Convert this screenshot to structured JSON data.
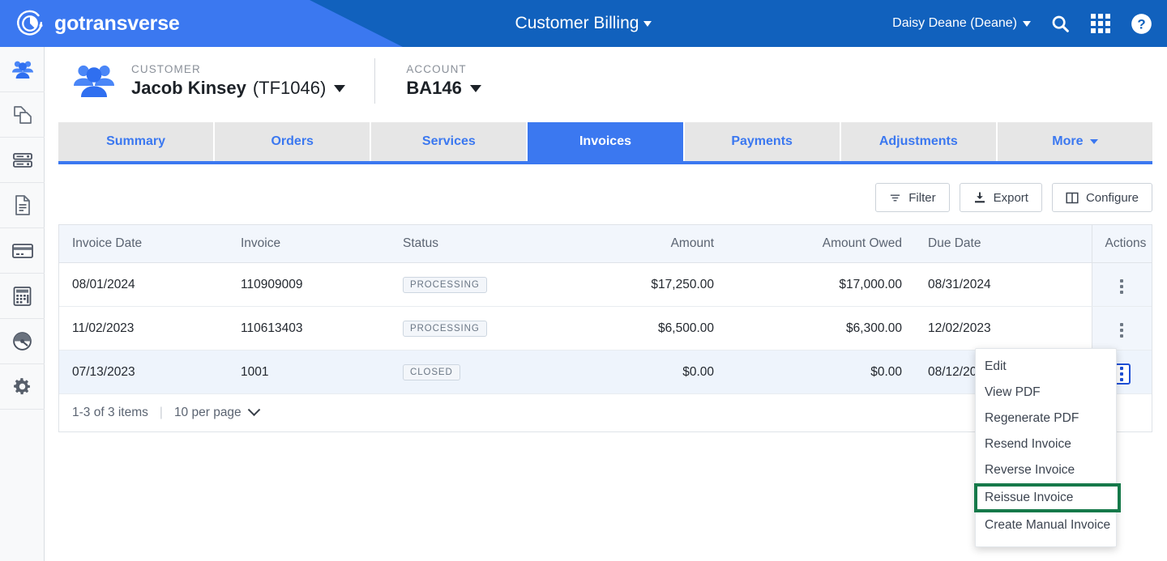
{
  "topbar": {
    "brand": "gotransverse",
    "title": "Customer Billing",
    "user": "Daisy Deane (Deane)",
    "icons": {
      "search": "search-icon",
      "apps": "apps-grid-icon",
      "help": "help-circle-icon"
    },
    "colors": {
      "wedge": "#3b78f0",
      "base": "#1161bd"
    }
  },
  "sidebar": {
    "items": [
      {
        "name": "customers",
        "active": true
      },
      {
        "name": "products",
        "active": false
      },
      {
        "name": "rates",
        "active": false
      },
      {
        "name": "documents",
        "active": false
      },
      {
        "name": "billing",
        "active": false
      },
      {
        "name": "accounting",
        "active": false
      },
      {
        "name": "dashboard",
        "active": false
      },
      {
        "name": "settings",
        "active": false
      }
    ]
  },
  "context": {
    "customer_label": "CUSTOMER",
    "customer_name": "Jacob Kinsey",
    "customer_id": "(TF1046)",
    "account_label": "ACCOUNT",
    "account_value": "BA146"
  },
  "tabs": [
    {
      "label": "Summary",
      "active": false,
      "caret": false
    },
    {
      "label": "Orders",
      "active": false,
      "caret": false
    },
    {
      "label": "Services",
      "active": false,
      "caret": false
    },
    {
      "label": "Invoices",
      "active": true,
      "caret": false
    },
    {
      "label": "Payments",
      "active": false,
      "caret": false
    },
    {
      "label": "Adjustments",
      "active": false,
      "caret": false
    },
    {
      "label": "More",
      "active": false,
      "caret": true
    }
  ],
  "toolbar": {
    "filter_label": "Filter",
    "export_label": "Export",
    "configure_label": "Configure"
  },
  "table": {
    "headers": [
      "Invoice Date",
      "Invoice",
      "Status",
      "Amount",
      "Amount Owed",
      "Due Date",
      "Actions"
    ],
    "rows": [
      {
        "invoice_date": "08/01/2024",
        "invoice": "110909009",
        "status": "PROCESSING",
        "amount": "$17,250.00",
        "amount_owed": "$17,000.00",
        "due_date": "08/31/2024",
        "selected": false,
        "actions_focused": false
      },
      {
        "invoice_date": "11/02/2023",
        "invoice": "110613403",
        "status": "PROCESSING",
        "amount": "$6,500.00",
        "amount_owed": "$6,300.00",
        "due_date": "12/02/2023",
        "selected": false,
        "actions_focused": false
      },
      {
        "invoice_date": "07/13/2023",
        "invoice": "1001",
        "status": "CLOSED",
        "amount": "$0.00",
        "amount_owed": "$0.00",
        "due_date": "08/12/2023",
        "selected": true,
        "actions_focused": true
      }
    ]
  },
  "pager": {
    "range": "1-3 of 3 items",
    "separator": "|",
    "per_page": "10 per page"
  },
  "context_menu": {
    "items": [
      {
        "label": "Edit",
        "highlight": false
      },
      {
        "label": "View PDF",
        "highlight": false
      },
      {
        "label": "Regenerate PDF",
        "highlight": false
      },
      {
        "label": "Resend Invoice",
        "highlight": false
      },
      {
        "label": "Reverse Invoice",
        "highlight": false
      },
      {
        "label": "Reissue Invoice",
        "highlight": true
      },
      {
        "label": "Create Manual Invoice",
        "highlight": false
      }
    ],
    "highlight_color": "#16794a"
  }
}
